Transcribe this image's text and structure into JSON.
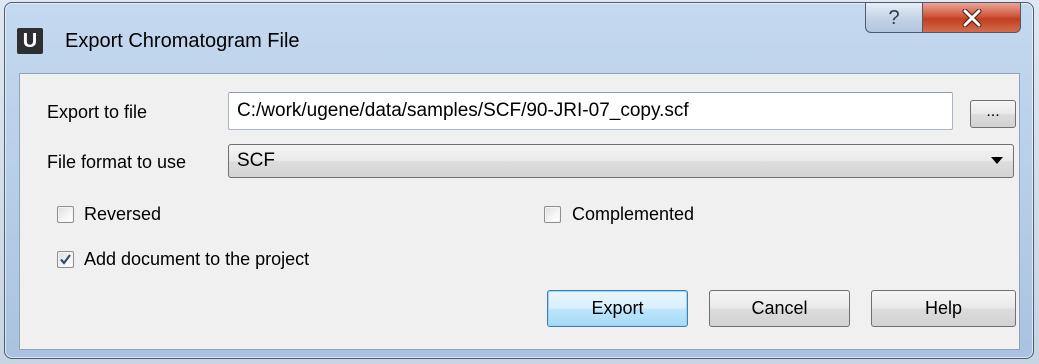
{
  "window": {
    "title": "Export Chromatogram File",
    "app_icon_letter": "U",
    "help_caption": "?"
  },
  "form": {
    "export_to_file_label": "Export to file",
    "export_to_file_value": "C:/work/ugene/data/samples/SCF/90-JRI-07_copy.scf",
    "browse_label": "...",
    "file_format_label": "File format to use",
    "file_format_value": "SCF",
    "reversed": {
      "label": "Reversed",
      "checked": false
    },
    "complemented": {
      "label": "Complemented",
      "checked": false
    },
    "add_to_project": {
      "label": "Add document to the project",
      "checked": true
    }
  },
  "buttons": {
    "export": "Export",
    "cancel": "Cancel",
    "help": "Help"
  },
  "icons": {
    "app": "ugene-app-icon",
    "help": "question-icon",
    "close": "close-x-icon",
    "dropdown": "chevron-down-icon",
    "check": "checkmark-icon"
  },
  "colors": {
    "close_button": "#c94a2e",
    "default_button": "#bee6fd",
    "client_background": "#f0f0f0",
    "check_color": "#2c4d7a"
  }
}
